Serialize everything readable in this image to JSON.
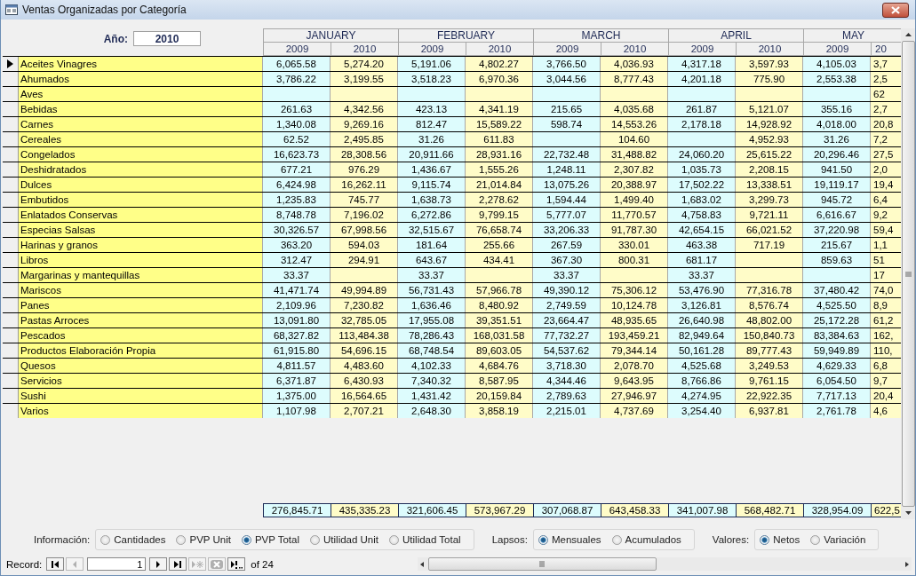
{
  "window": {
    "title": "Ventas Organizadas por Categoría"
  },
  "year_filter": {
    "label": "Año:",
    "value": "2010"
  },
  "months": [
    {
      "name": "JANUARY",
      "years": [
        "2009",
        "2010"
      ]
    },
    {
      "name": "FEBRUARY",
      "years": [
        "2009",
        "2010"
      ]
    },
    {
      "name": "MARCH",
      "years": [
        "2009",
        "2010"
      ]
    },
    {
      "name": "APRIL",
      "years": [
        "2009",
        "2010"
      ]
    },
    {
      "name": "MAY",
      "years": [
        "2009",
        "20"
      ]
    }
  ],
  "rows": [
    {
      "label": "Aceites Vinagres",
      "selected": true,
      "values": {
        "0": "6,065.58",
        "1": "5,274.20",
        "2": "5,191.06",
        "3": "4,802.27",
        "4": "3,766.50",
        "5": "4,036.93",
        "6": "4,317.18",
        "7": "3,597.93",
        "8": "4,105.03",
        "9": "3,7"
      }
    },
    {
      "label": "Ahumados",
      "selected": false,
      "values": {
        "0": "3,786.22",
        "1": "3,199.55",
        "2": "3,518.23",
        "3": "6,970.36",
        "4": "3,044.56",
        "5": "8,777.43",
        "6": "4,201.18",
        "7": "775.90",
        "8": "2,553.38",
        "9": "2,5"
      }
    },
    {
      "label": "Aves",
      "selected": false,
      "values": {
        "9": "62"
      }
    },
    {
      "label": "Bebidas",
      "selected": false,
      "values": {
        "0": "261.63",
        "1": "4,342.56",
        "2": "423.13",
        "3": "4,341.19",
        "4": "215.65",
        "5": "4,035.68",
        "6": "261.87",
        "7": "5,121.07",
        "8": "355.16",
        "9": "2,7"
      }
    },
    {
      "label": "Carnes",
      "selected": false,
      "values": {
        "0": "1,340.08",
        "1": "9,269.16",
        "2": "812.47",
        "3": "15,589.22",
        "4": "598.74",
        "5": "14,553.26",
        "6": "2,178.18",
        "7": "14,928.92",
        "8": "4,018.00",
        "9": "20,8"
      }
    },
    {
      "label": "Cereales",
      "selected": false,
      "values": {
        "0": "62.52",
        "1": "2,495.85",
        "2": "31.26",
        "3": "611.83",
        "5": "104.60",
        "7": "4,952.93",
        "8": "31.26",
        "9": "7,2"
      }
    },
    {
      "label": "Congelados",
      "selected": false,
      "values": {
        "0": "16,623.73",
        "1": "28,308.56",
        "2": "20,911.66",
        "3": "28,931.16",
        "4": "22,732.48",
        "5": "31,488.82",
        "6": "24,060.20",
        "7": "25,615.22",
        "8": "20,296.46",
        "9": "27,5"
      }
    },
    {
      "label": "Deshidratados",
      "selected": false,
      "values": {
        "0": "677.21",
        "1": "976.29",
        "2": "1,436.67",
        "3": "1,555.26",
        "4": "1,248.11",
        "5": "2,307.82",
        "6": "1,035.73",
        "7": "2,208.15",
        "8": "941.50",
        "9": "2,0"
      }
    },
    {
      "label": "Dulces",
      "selected": false,
      "values": {
        "0": "6,424.98",
        "1": "16,262.11",
        "2": "9,115.74",
        "3": "21,014.84",
        "4": "13,075.26",
        "5": "20,388.97",
        "6": "17,502.22",
        "7": "13,338.51",
        "8": "19,119.17",
        "9": "19,4"
      }
    },
    {
      "label": "Embutidos",
      "selected": false,
      "values": {
        "0": "1,235.83",
        "1": "745.77",
        "2": "1,638.73",
        "3": "2,278.62",
        "4": "1,594.44",
        "5": "1,499.40",
        "6": "1,683.02",
        "7": "3,299.73",
        "8": "945.72",
        "9": "6,4"
      }
    },
    {
      "label": "Enlatados Conservas",
      "selected": false,
      "values": {
        "0": "8,748.78",
        "1": "7,196.02",
        "2": "6,272.86",
        "3": "9,799.15",
        "4": "5,777.07",
        "5": "11,770.57",
        "6": "4,758.83",
        "7": "9,721.11",
        "8": "6,616.67",
        "9": "9,2"
      }
    },
    {
      "label": "Especias Salsas",
      "selected": false,
      "values": {
        "0": "30,326.57",
        "1": "67,998.56",
        "2": "32,515.67",
        "3": "76,658.74",
        "4": "33,206.33",
        "5": "91,787.30",
        "6": "42,654.15",
        "7": "66,021.52",
        "8": "37,220.98",
        "9": "59,4"
      }
    },
    {
      "label": "Harinas y granos",
      "selected": false,
      "values": {
        "0": "363.20",
        "1": "594.03",
        "2": "181.64",
        "3": "255.66",
        "4": "267.59",
        "5": "330.01",
        "6": "463.38",
        "7": "717.19",
        "8": "215.67",
        "9": "1,1"
      }
    },
    {
      "label": "Libros",
      "selected": false,
      "values": {
        "0": "312.47",
        "1": "294.91",
        "2": "643.67",
        "3": "434.41",
        "4": "367.30",
        "5": "800.31",
        "6": "681.17",
        "8": "859.63",
        "9": "51"
      }
    },
    {
      "label": "Margarinas y mantequillas",
      "selected": false,
      "values": {
        "0": "33.37",
        "2": "33.37",
        "4": "33.37",
        "6": "33.37",
        "9": "17"
      }
    },
    {
      "label": "Mariscos",
      "selected": false,
      "values": {
        "0": "41,471.74",
        "1": "49,994.89",
        "2": "56,731.43",
        "3": "57,966.78",
        "4": "49,390.12",
        "5": "75,306.12",
        "6": "53,476.90",
        "7": "77,316.78",
        "8": "37,480.42",
        "9": "74,0"
      }
    },
    {
      "label": "Panes",
      "selected": false,
      "values": {
        "0": "2,109.96",
        "1": "7,230.82",
        "2": "1,636.46",
        "3": "8,480.92",
        "4": "2,749.59",
        "5": "10,124.78",
        "6": "3,126.81",
        "7": "8,576.74",
        "8": "4,525.50",
        "9": "8,9"
      }
    },
    {
      "label": "Pastas Arroces",
      "selected": false,
      "values": {
        "0": "13,091.80",
        "1": "32,785.05",
        "2": "17,955.08",
        "3": "39,351.51",
        "4": "23,664.47",
        "5": "48,935.65",
        "6": "26,640.98",
        "7": "48,802.00",
        "8": "25,172.28",
        "9": "61,2"
      }
    },
    {
      "label": "Pescados",
      "selected": false,
      "values": {
        "0": "68,327.82",
        "1": "113,484.38",
        "2": "78,286.43",
        "3": "168,031.58",
        "4": "77,732.27",
        "5": "193,459.21",
        "6": "82,949.64",
        "7": "150,840.73",
        "8": "83,384.63",
        "9": "162,"
      }
    },
    {
      "label": "Productos Elaboración Propia",
      "selected": false,
      "values": {
        "0": "61,915.80",
        "1": "54,696.15",
        "2": "68,748.54",
        "3": "89,603.05",
        "4": "54,537.62",
        "5": "79,344.14",
        "6": "50,161.28",
        "7": "89,777.43",
        "8": "59,949.89",
        "9": "110,"
      }
    },
    {
      "label": "Quesos",
      "selected": false,
      "values": {
        "0": "4,811.57",
        "1": "4,483.60",
        "2": "4,102.33",
        "3": "4,684.76",
        "4": "3,718.30",
        "5": "2,078.70",
        "6": "4,525.68",
        "7": "3,249.53",
        "8": "4,629.33",
        "9": "6,8"
      }
    },
    {
      "label": "Servicios",
      "selected": false,
      "values": {
        "0": "6,371.87",
        "1": "6,430.93",
        "2": "7,340.32",
        "3": "8,587.95",
        "4": "4,344.46",
        "5": "9,643.95",
        "6": "8,766.86",
        "7": "9,761.15",
        "8": "6,054.50",
        "9": "9,7"
      }
    },
    {
      "label": "Sushi",
      "selected": false,
      "values": {
        "0": "1,375.00",
        "1": "16,564.65",
        "2": "1,431.42",
        "3": "20,159.84",
        "4": "2,789.63",
        "5": "27,946.97",
        "6": "4,274.95",
        "7": "22,922.35",
        "8": "7,717.13",
        "9": "20,4"
      }
    },
    {
      "label": "Varios",
      "selected": false,
      "values": {
        "0": "1,107.98",
        "1": "2,707.21",
        "2": "2,648.30",
        "3": "3,858.19",
        "4": "2,215.01",
        "5": "4,737.69",
        "6": "3,254.40",
        "7": "6,937.81",
        "8": "2,761.78",
        "9": "4,6"
      }
    }
  ],
  "totals": [
    "276,845.71",
    "435,335.23",
    "321,606.45",
    "573,967.29",
    "307,068.87",
    "643,458.33",
    "341,007.98",
    "568,482.71",
    "328,954.09",
    "622,5"
  ],
  "option_groups": [
    {
      "label": "Información:",
      "options": [
        {
          "label": "Cantidades",
          "selected": false
        },
        {
          "label": "PVP Unit",
          "selected": false
        },
        {
          "label": "PVP Total",
          "selected": true
        },
        {
          "label": "Utilidad Unit",
          "selected": false
        },
        {
          "label": "Utilidad Total",
          "selected": false
        }
      ]
    },
    {
      "label": "Lapsos:",
      "options": [
        {
          "label": "Mensuales",
          "selected": true
        },
        {
          "label": "Acumulados",
          "selected": false
        }
      ]
    },
    {
      "label": "Valores:",
      "options": [
        {
          "label": "Netos",
          "selected": true
        },
        {
          "label": "Variación",
          "selected": false
        }
      ]
    }
  ],
  "record_nav": {
    "label": "Record:",
    "current": "1",
    "count": "of 24",
    "buttons": [
      {
        "kind": "first",
        "disabled": false
      },
      {
        "kind": "prev",
        "disabled": true
      }
    ],
    "buttons_after": [
      {
        "kind": "next",
        "disabled": false
      },
      {
        "kind": "last",
        "disabled": false
      },
      {
        "kind": "new",
        "disabled": true
      },
      {
        "kind": "delete",
        "disabled": true
      },
      {
        "kind": "search",
        "disabled": false
      }
    ]
  }
}
